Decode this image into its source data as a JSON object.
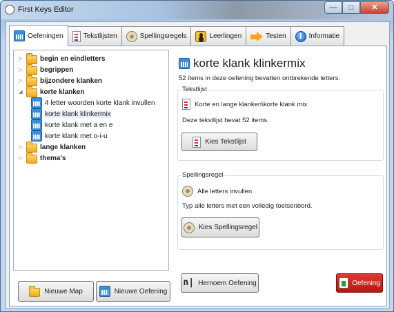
{
  "window": {
    "title": "First Keys Editor",
    "min_label": "—",
    "max_label": "□",
    "close_label": "✕"
  },
  "tabs": [
    {
      "label": "Oefeningen",
      "icon": "grid-icon"
    },
    {
      "label": "Tekstlijsten",
      "icon": "document-icon"
    },
    {
      "label": "Spellingsregels",
      "icon": "badge-icon"
    },
    {
      "label": "Leerlingen",
      "icon": "person-icon"
    },
    {
      "label": "Testen",
      "icon": "arrow-icon"
    },
    {
      "label": "Informatie",
      "icon": "info-icon"
    }
  ],
  "tree": {
    "items": [
      {
        "label": "begin en eindletters"
      },
      {
        "label": "begrippen"
      },
      {
        "label": "bijzondere klanken"
      },
      {
        "label": "korte klanken"
      },
      {
        "label": "4 letter woorden korte klank invullen"
      },
      {
        "label": "korte klank klinkermix"
      },
      {
        "label": "korte klank met a en e"
      },
      {
        "label": "korte klank met o-i-u"
      },
      {
        "label": "lange klanken"
      },
      {
        "label": "thema's"
      }
    ],
    "expanded_glyph": "◢",
    "collapsed_glyph": "▷"
  },
  "left_buttons": {
    "new_folder": "Nieuwe Map",
    "new_exercise": "Nieuwe Oefening"
  },
  "detail": {
    "title": "korte klank klinkermix",
    "description": "52 items in deze oefening bevatten ontbrekende letters.",
    "textlist": {
      "legend": "Tekstlijst",
      "name": "Korte en lange klanken\\korte klank mix",
      "note": "Deze tekstlijst bevat 52 items.",
      "button": "Kies Tekstlijst"
    },
    "spelling": {
      "legend": "Spellingsregel",
      "name": "Alle letters invullen",
      "note": "Typ alle letters met een volledig toetsenbord.",
      "button": "Kies Spellingsregel"
    },
    "rename_button": "Hernoem Oefening",
    "delete_button": "Oefening"
  },
  "colors": {
    "accent": "#3b8ed7",
    "danger": "#c8221a",
    "folder": "#f0b52a"
  },
  "info_glyph": "i"
}
